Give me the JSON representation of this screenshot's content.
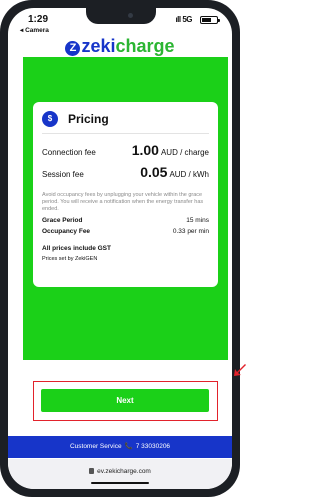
{
  "status": {
    "time": "1:29",
    "back_app": "◂ Camera",
    "signal": "5G"
  },
  "logo": {
    "mark": "Z",
    "brand_part1": "zeki",
    "brand_part2": "charge"
  },
  "pricing": {
    "title": "Pricing",
    "icon": "dollar-icon",
    "connection_fee": {
      "label": "Connection fee",
      "amount": "1.00",
      "unit": "AUD / charge"
    },
    "session_fee": {
      "label": "Session fee",
      "amount": "0.05",
      "unit": "AUD / kWh"
    },
    "note": "Avoid occupancy fees by unplugging your vehicle within the grace period. You will receive a notification when the energy transfer has ended.",
    "grace_period": {
      "label": "Grace Period",
      "value": "15 mins"
    },
    "occupancy_fee": {
      "label": "Occupancy Fee",
      "value": "0.33 per min"
    },
    "gst_note": "All prices include GST",
    "prices_set_by": "Prices set by ZekiGEN"
  },
  "actions": {
    "next_label": "Next"
  },
  "footer": {
    "service_label": "Customer Service",
    "phone_number": "7 33030206",
    "phone_icon": "phone-icon"
  },
  "browser": {
    "url": "ev.zekicharge.com",
    "lock_icon": "lock-icon"
  },
  "colors": {
    "brand_blue": "#1735c9",
    "brand_green": "#1bd018",
    "highlight_red": "#e2222b"
  }
}
